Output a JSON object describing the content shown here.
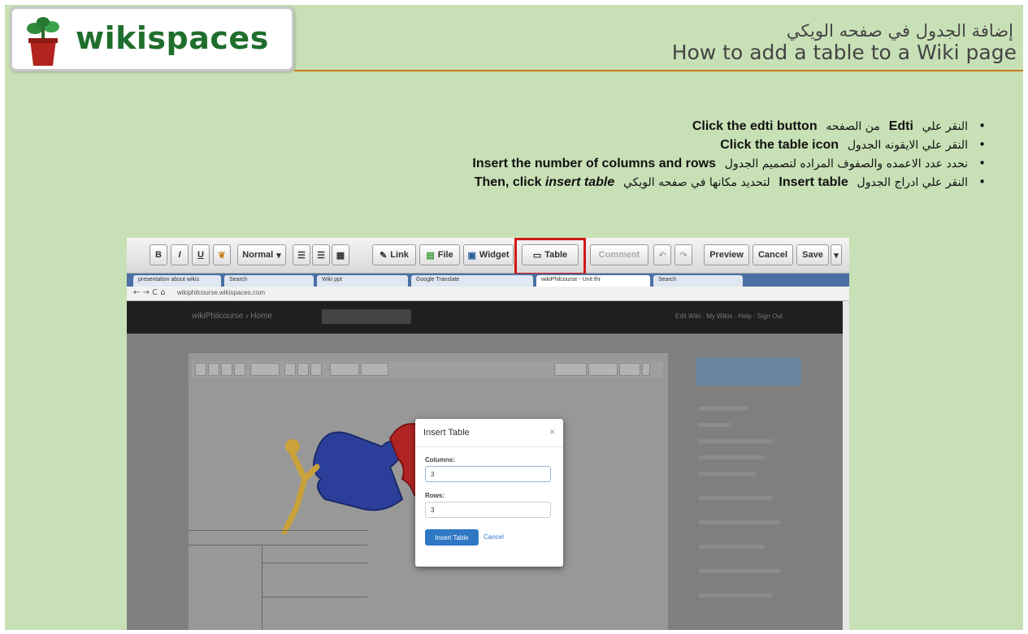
{
  "header": {
    "logo_text": "wikispaces",
    "title_ar": "إضافة الجدول في صفحه الويكي",
    "title_en": "How to add a table to a Wiki page"
  },
  "bullets": [
    {
      "ar": "النقر علي",
      "en1": "Edti",
      "ar2": "من الصفحه",
      "en2": "Click the edti button"
    },
    {
      "ar": "النقر علي الايقونه الجدول",
      "en": "Click the table icon"
    },
    {
      "ar": "نحدد عدد الاعمده والصفوف المراده لتصميم الجدول",
      "en": "Insert the number of columns and rows"
    },
    {
      "ar": "النقر علي ادراج الجدول",
      "en1": "Insert table",
      "ar2": "لتحديد مكانها في صفحه الويكي",
      "en2_prefix": "Then, click",
      "en2_em": "insert table"
    }
  ],
  "editor_toolbar": {
    "bold": "B",
    "italic": "I",
    "underline": "U",
    "format": "Normal",
    "link": "Link",
    "file": "File",
    "widget": "Widget",
    "table": "Table",
    "comment": "Comment",
    "preview": "Preview",
    "cancel": "Cancel",
    "save": "Save"
  },
  "browser": {
    "tabs": [
      "presentation about wikis",
      "Search",
      "Wiki ppt",
      "Google Translate",
      "wikiPhilcourse - Unit thr",
      "Search"
    ],
    "url": "wikiphilcourse.wikispaces.com"
  },
  "site": {
    "title": "wikiPhilcourse › Home",
    "links": "Edit Wiki · My Wikis · Help · Sign Out"
  },
  "modal": {
    "title": "Insert Table",
    "close": "×",
    "columns_label": "Columns:",
    "columns_value": "3",
    "rows_label": "Rows:",
    "rows_value": "3",
    "insert_button": "Insert Table",
    "cancel_link": "Cancel"
  },
  "colors": {
    "slide_bg": "#c8e0b6",
    "logo_green": "#1f6e2d",
    "header_rule": "#c87a1e",
    "highlight_red": "#d01818",
    "primary_blue": "#2f78c4"
  }
}
